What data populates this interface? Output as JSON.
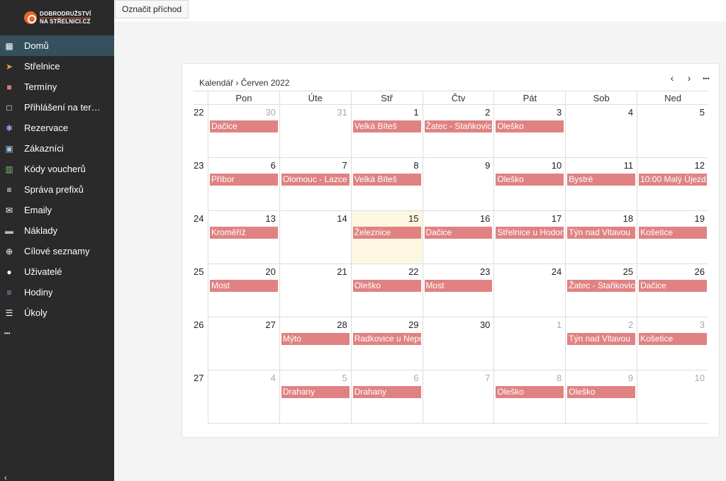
{
  "logo": {
    "line1": "DOBRODRUŽSTVÍ",
    "line2": "NA STŘELNICI.CZ"
  },
  "sidebar": {
    "items": [
      {
        "label": "Domů",
        "icon": "grid-icon",
        "glyph": "▦",
        "color": "#ffffff"
      },
      {
        "label": "Střelnice",
        "icon": "location-arrow-icon",
        "glyph": "➤",
        "color": "#d9a441"
      },
      {
        "label": "Termíny",
        "icon": "calendar-square-icon",
        "glyph": "■",
        "color": "#e07a7a"
      },
      {
        "label": "Přihlášení na ter…",
        "icon": "checkbox-icon",
        "glyph": "□",
        "color": "#ffffff"
      },
      {
        "label": "Rezervace",
        "icon": "asterisk-icon",
        "glyph": "✱",
        "color": "#8aa3e0"
      },
      {
        "label": "Zákazníci",
        "icon": "id-card-icon",
        "glyph": "▣",
        "color": "#9ec6e8"
      },
      {
        "label": "Kódy voucherů",
        "icon": "barcode-icon",
        "glyph": "▥",
        "color": "#7dbf6e"
      },
      {
        "label": "Správa prefixů",
        "icon": "align-left-icon",
        "glyph": "≡",
        "color": "#ffffff"
      },
      {
        "label": "Emaily",
        "icon": "envelope-icon",
        "glyph": "✉",
        "color": "#ffffff"
      },
      {
        "label": "Náklady",
        "icon": "money-icon",
        "glyph": "▬",
        "color": "#bbbbbb"
      },
      {
        "label": "Cílové seznamy",
        "icon": "crosshair-icon",
        "glyph": "⊕",
        "color": "#ffffff"
      },
      {
        "label": "Uživatelé",
        "icon": "user-circle-icon",
        "glyph": "●",
        "color": "#ffffff"
      },
      {
        "label": "Hodiny",
        "icon": "bars-icon",
        "glyph": "≡",
        "color": "#8aa3e0"
      },
      {
        "label": "Úkoly",
        "icon": "task-list-icon",
        "glyph": "☰",
        "color": "#ffffff"
      },
      {
        "label": "",
        "icon": "more-horizontal-icon",
        "glyph": "•••",
        "color": "#ffffff"
      }
    ],
    "active_index": 0,
    "collapse_glyph": "‹"
  },
  "topbar": {
    "checkin_label": "Označit příchod"
  },
  "calendar": {
    "breadcrumb_root": "Kalendář",
    "breadcrumb_sep": "›",
    "breadcrumb_month": "Červen 2022",
    "nav": {
      "prev": "‹",
      "next": "›",
      "more": "•••"
    },
    "day_names": [
      "Pon",
      "Úte",
      "Stř",
      "Čtv",
      "Pát",
      "Sob",
      "Ned"
    ],
    "event_color": "#e08282",
    "weeks": [
      {
        "week": "22",
        "days": [
          {
            "n": "30",
            "other": true,
            "ev": "Dačice"
          },
          {
            "n": "31",
            "other": true,
            "ev": ""
          },
          {
            "n": "1",
            "ev": "Velká Bíteš"
          },
          {
            "n": "2",
            "ev": "Žatec - Staňkovice"
          },
          {
            "n": "3",
            "ev": "Oleško"
          },
          {
            "n": "4",
            "ev": ""
          },
          {
            "n": "5",
            "ev": ""
          }
        ]
      },
      {
        "week": "23",
        "days": [
          {
            "n": "6",
            "ev": "Příbor"
          },
          {
            "n": "7",
            "ev": "Olomouc - Lazce"
          },
          {
            "n": "8",
            "ev": "Velká Bíteš"
          },
          {
            "n": "9",
            "ev": ""
          },
          {
            "n": "10",
            "ev": "Oleško"
          },
          {
            "n": "11",
            "ev": "Bystré"
          },
          {
            "n": "12",
            "ev": "10:00 Malý Újezd"
          }
        ]
      },
      {
        "week": "24",
        "days": [
          {
            "n": "13",
            "ev": "Kroměříž"
          },
          {
            "n": "14",
            "ev": ""
          },
          {
            "n": "15",
            "ev": "Železnice",
            "today": true
          },
          {
            "n": "16",
            "ev": "Dačice"
          },
          {
            "n": "17",
            "ev": "Střelnice u Hodoní"
          },
          {
            "n": "18",
            "ev": "Týn nad Vltavou"
          },
          {
            "n": "19",
            "ev": "Košetice"
          }
        ]
      },
      {
        "week": "25",
        "days": [
          {
            "n": "20",
            "ev": "Most"
          },
          {
            "n": "21",
            "ev": ""
          },
          {
            "n": "22",
            "ev": "Oleško"
          },
          {
            "n": "23",
            "ev": "Most"
          },
          {
            "n": "24",
            "ev": ""
          },
          {
            "n": "25",
            "ev": "Žatec - Staňkovice"
          },
          {
            "n": "26",
            "ev": "Dačice"
          }
        ]
      },
      {
        "week": "26",
        "days": [
          {
            "n": "27",
            "ev": ""
          },
          {
            "n": "28",
            "ev": "Mýto"
          },
          {
            "n": "29",
            "ev": "Radkovice u Nepomuku"
          },
          {
            "n": "30",
            "ev": ""
          },
          {
            "n": "1",
            "other": true,
            "ev": ""
          },
          {
            "n": "2",
            "other": true,
            "ev": "Týn nad Vltavou"
          },
          {
            "n": "3",
            "other": true,
            "ev": "Košetice"
          }
        ]
      },
      {
        "week": "27",
        "days": [
          {
            "n": "4",
            "other": true,
            "ev": ""
          },
          {
            "n": "5",
            "other": true,
            "ev": "Drahany"
          },
          {
            "n": "6",
            "other": true,
            "ev": "Drahany"
          },
          {
            "n": "7",
            "other": true,
            "ev": ""
          },
          {
            "n": "8",
            "other": true,
            "ev": "Oleško"
          },
          {
            "n": "9",
            "other": true,
            "ev": "Oleško"
          },
          {
            "n": "10",
            "other": true,
            "ev": ""
          }
        ]
      }
    ]
  }
}
